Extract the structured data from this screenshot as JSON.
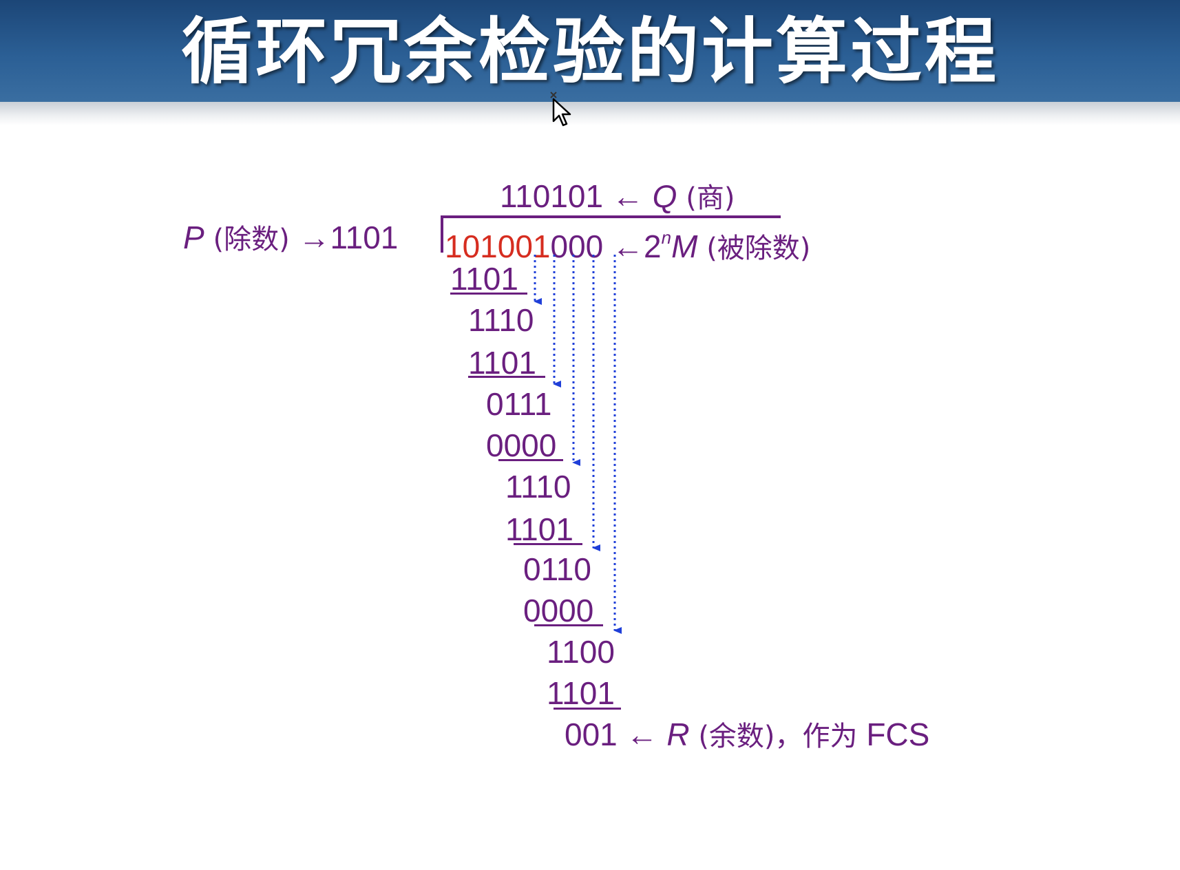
{
  "title": "循环冗余检验的计算过程",
  "colors": {
    "header_bg": "#2b5f95",
    "text_purple": "#6a1f7f",
    "highlight_red": "#d62d20",
    "arrow_blue": "#1f3fd8"
  },
  "quotient": {
    "value": "110101",
    "arrow": "←",
    "symbol": "Q",
    "label": "(商)"
  },
  "divisor": {
    "symbol": "P",
    "label": "(除数)",
    "arrow": "→",
    "value": "1101"
  },
  "dividend": {
    "highlighted": "101001",
    "padding": "000",
    "arrow": "←",
    "base": "2",
    "exponent": "n",
    "symbol": "M",
    "label": "(被除数)"
  },
  "steps": [
    "1101",
    "1110",
    "1101",
    "0111",
    "0000",
    "1110",
    "1101",
    "0110",
    "0000",
    "1100",
    "1101"
  ],
  "remainder": {
    "value": "001",
    "arrow": "←",
    "symbol": "R",
    "label": "(余数)，",
    "note": "作为",
    "fcs": "FCS"
  }
}
